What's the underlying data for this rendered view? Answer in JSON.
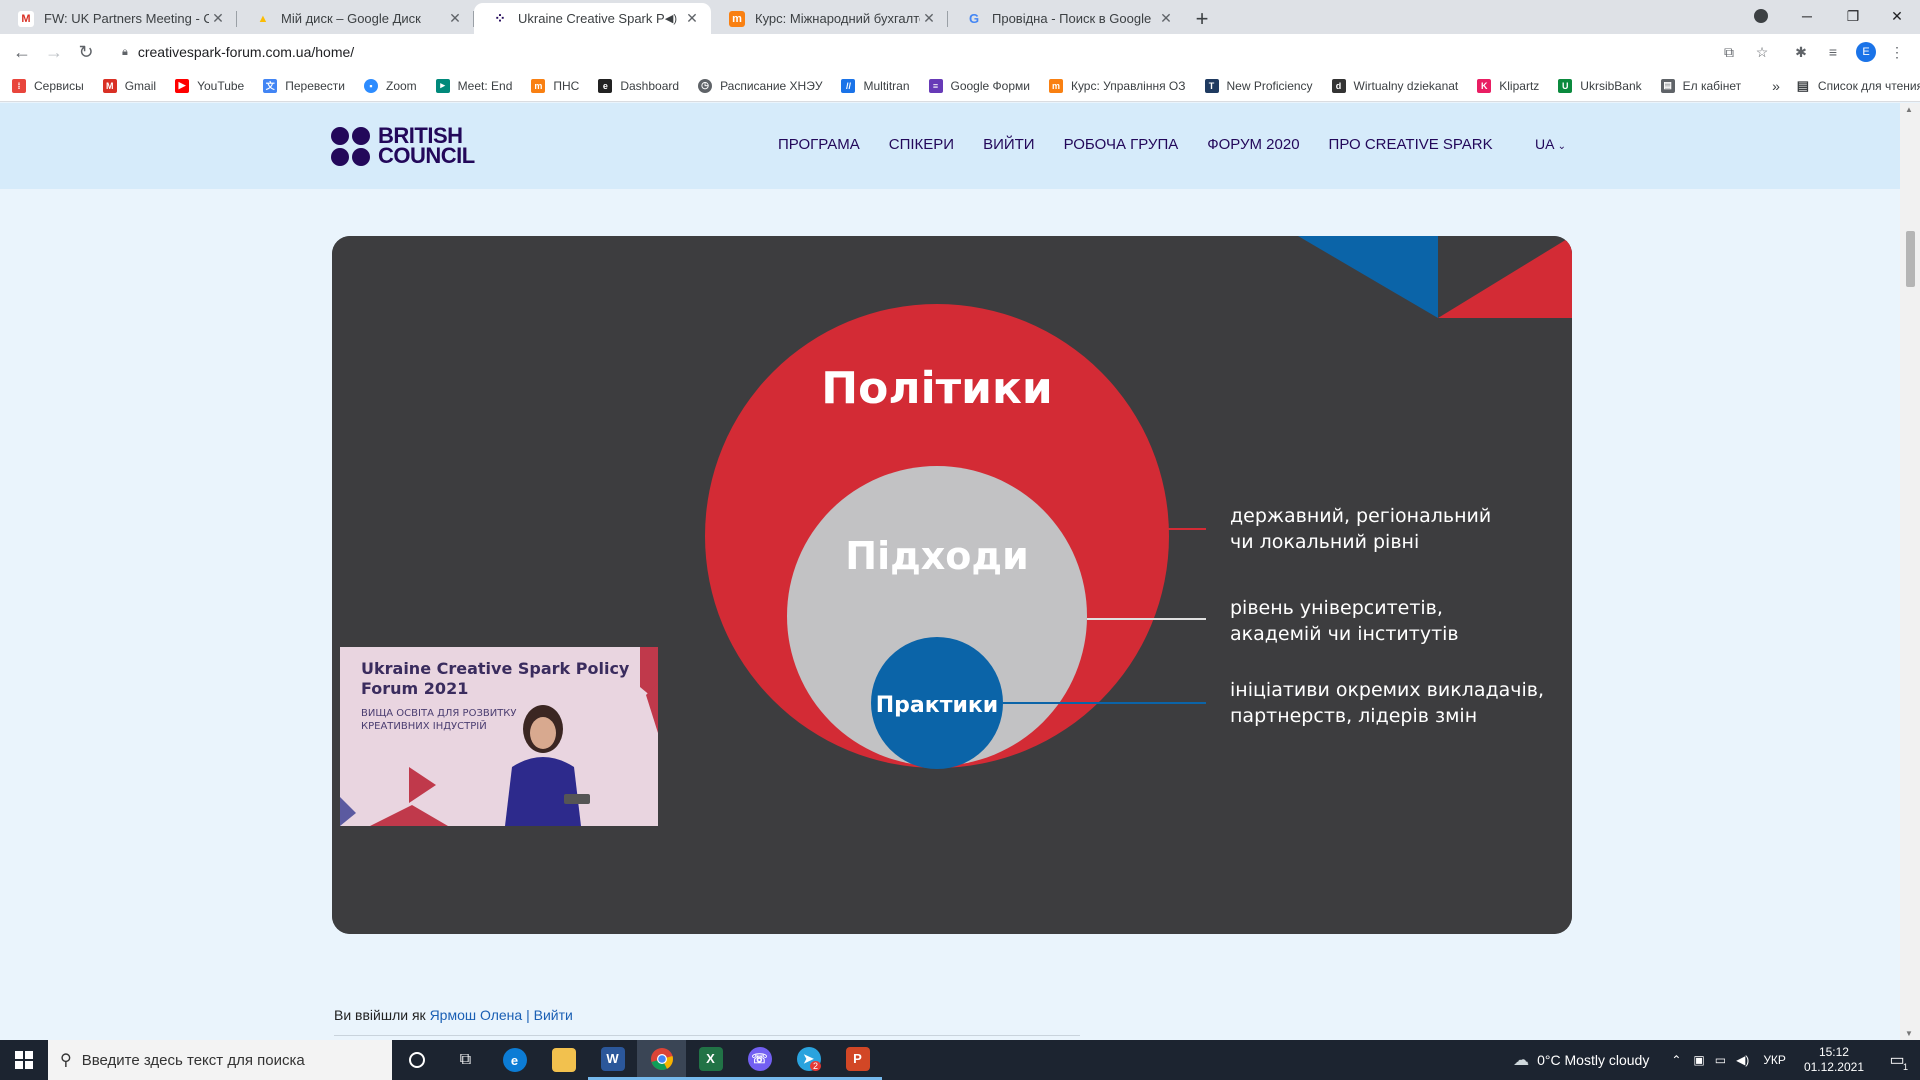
{
  "browser": {
    "tabs": [
      {
        "title": "FW: UK Partners Meeting - Creati",
        "favicon": "gmail-icon",
        "color": "#d93025",
        "glyph": "M"
      },
      {
        "title": "Мій диск – Google Диск",
        "favicon": "google-drive-icon",
        "color": "#fbbc04",
        "glyph": "▲"
      },
      {
        "title": "Ukraine Creative Spark Policy",
        "favicon": "british-council-icon",
        "color": "#23085a",
        "glyph": "●"
      },
      {
        "title": "Курс: Міжнародний бухгалтерсь",
        "favicon": "moodle-icon",
        "color": "#f98012",
        "glyph": "m"
      },
      {
        "title": "Провідна - Поиск в Google",
        "favicon": "google-icon",
        "color": "#4285f4",
        "glyph": "G"
      }
    ],
    "url": "creativespark-forum.com.ua/home/",
    "profile_initial": "E",
    "bookmarks": [
      {
        "label": "Сервисы",
        "icon": "apps-grid-icon",
        "color": "#e8453c"
      },
      {
        "label": "Gmail",
        "icon": "gmail-icon",
        "color": "#d93025"
      },
      {
        "label": "YouTube",
        "icon": "youtube-icon",
        "color": "#ff0000"
      },
      {
        "label": "Перевести",
        "icon": "translate-icon",
        "color": "#4285f4"
      },
      {
        "label": "Zoom",
        "icon": "zoom-icon",
        "color": "#2d8cff"
      },
      {
        "label": "Meet: End",
        "icon": "meet-icon",
        "color": "#00897b"
      },
      {
        "label": "ПНС",
        "icon": "moodle-icon",
        "color": "#f98012"
      },
      {
        "label": "Dashboard",
        "icon": "dashboard-icon",
        "color": "#222222"
      },
      {
        "label": "Расписание ХНЭУ",
        "icon": "clock-icon",
        "color": "#5f6368"
      },
      {
        "label": "Multitran",
        "icon": "multitran-icon",
        "color": "#1a73e8"
      },
      {
        "label": "Google Форми",
        "icon": "google-forms-icon",
        "color": "#673ab7"
      },
      {
        "label": "Курс: Управління ОЗ",
        "icon": "moodle-icon",
        "color": "#f98012"
      },
      {
        "label": "New Proficiency",
        "icon": "t-icon",
        "color": "#1f3a60"
      },
      {
        "label": "Wirtualny dziekanat",
        "icon": "wd-icon",
        "color": "#333333"
      },
      {
        "label": "Klipartz",
        "icon": "klipartz-icon",
        "color": "#e91e63"
      },
      {
        "label": "UkrsibBank",
        "icon": "ukrsib-icon",
        "color": "#0b8a3e"
      },
      {
        "label": "Ел кабінет",
        "icon": "document-icon",
        "color": "#5f6368"
      }
    ],
    "more_bookmarks": "»",
    "reading_list": "Список для чтения"
  },
  "site": {
    "nav": [
      "ПРОГРАМА",
      "СПІКЕРИ",
      "ВИЙТИ",
      "РОБОЧА ГРУПА",
      "ФОРУМ 2020",
      "ПРО CREATIVE SPARK"
    ],
    "lang": "UA",
    "logo_line1": "BRITISH",
    "logo_line2": "COUNCIL"
  },
  "slide": {
    "outer_label": "Політики",
    "middle_label": "Підходи",
    "inner_label": "Практики",
    "desc1_line1": "державний, регіональний",
    "desc1_line2": "чи локальний рівні",
    "desc2_line1": "рівень університетів,",
    "desc2_line2": "академій чи інститутів",
    "desc3_line1": "ініціативи окремих викладачів,",
    "desc3_line2": "партнерств, лідерів змін",
    "colors": {
      "red": "#d32b35",
      "grey": "#c2c2c4",
      "blue": "#0b64a8",
      "bg": "#3d3d3f"
    }
  },
  "pip": {
    "title": "Ukraine Creative Spark Policy Forum 2021",
    "subtitle": "ВИЩА ОСВІТА ДЛЯ РОЗВИТКУ КРЕАТИВНИХ ІНДУСТРІЙ"
  },
  "login": {
    "prefix": "Ви ввійшли як",
    "user": "Ярмош Олена",
    "separator": "|",
    "logout": "Вийти"
  },
  "taskbar": {
    "search_placeholder": "Введите здесь текст для поиска",
    "weather": "0°C  Mostly cloudy",
    "lang": "УКР",
    "time": "15:12",
    "date": "01.12.2021",
    "notifications": "1",
    "telegram_badge": "2"
  }
}
